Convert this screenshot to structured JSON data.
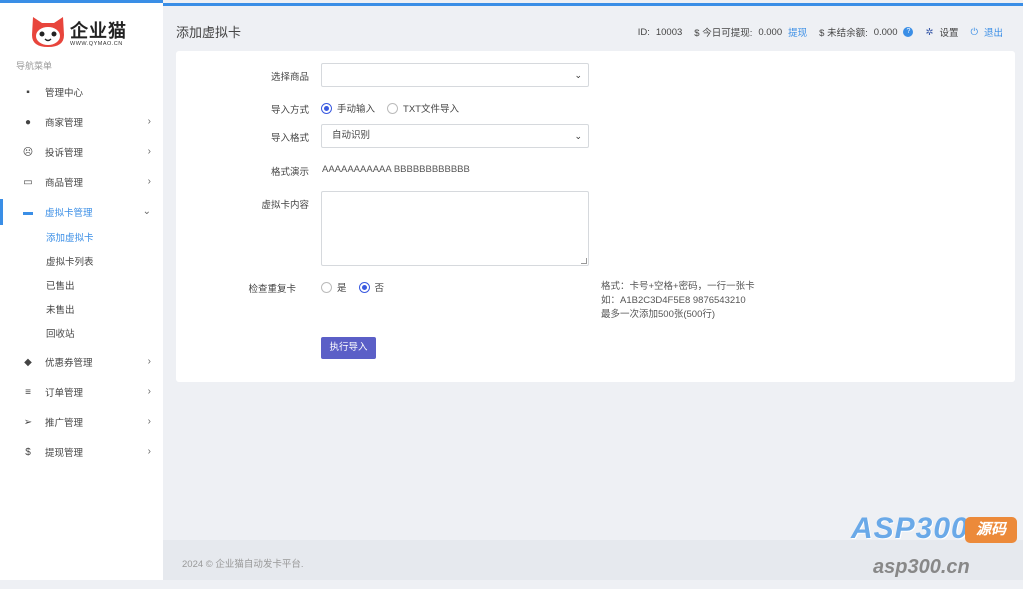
{
  "brand": {
    "name": "企业猫",
    "sub": "WWW.QYMAO.CN"
  },
  "sidebar": {
    "caption": "导航菜单",
    "items": [
      {
        "label": "管理中心",
        "icon": "dashboard-icon",
        "arrow": false
      },
      {
        "label": "商家管理",
        "icon": "user-icon",
        "arrow": true
      },
      {
        "label": "投诉管理",
        "icon": "complaint-icon",
        "arrow": true
      },
      {
        "label": "商品管理",
        "icon": "store-icon",
        "arrow": true
      },
      {
        "label": "虚拟卡管理",
        "icon": "card-icon",
        "arrow": true,
        "active": true
      },
      {
        "label": "优惠券管理",
        "icon": "tag-icon",
        "arrow": true
      },
      {
        "label": "订单管理",
        "icon": "list-icon",
        "arrow": true
      },
      {
        "label": "推广管理",
        "icon": "send-icon",
        "arrow": true
      },
      {
        "label": "提现管理",
        "icon": "dollar-icon",
        "arrow": true
      }
    ],
    "sub_items": [
      "添加虚拟卡",
      "虚拟卡列表",
      "已售出",
      "未售出",
      "回收站"
    ]
  },
  "header": {
    "title": "添加虚拟卡",
    "id_label": "ID:",
    "id_value": "10003",
    "withdraw_label": "$ 今日可提现:",
    "withdraw_value": "0.000",
    "withdraw_link": "提现",
    "unsettled_label": "$ 未结余额:",
    "unsettled_value": "0.000",
    "settings": "设置",
    "logout": "退出"
  },
  "form": {
    "product_label": "选择商品",
    "product_value": "",
    "import_mode_label": "导入方式",
    "import_modes": [
      "手动输入",
      "TXT文件导入"
    ],
    "import_mode_selected": "手动输入",
    "format_label": "导入格式",
    "format_value": "自动识别",
    "demo_label": "格式演示",
    "demo_value": "AAAAAAAAAAA BBBBBBBBBBBB",
    "content_label": "虚拟卡内容",
    "content_value": "",
    "dup_label": "检查重复卡",
    "dup_options": [
      "是",
      "否"
    ],
    "dup_selected": "否",
    "hint_lines": [
      "格式：卡号+空格+密码，一行一张卡",
      "如：A1B2C3D4F5E8 9876543210",
      "最多一次添加500张(500行)"
    ],
    "submit": "执行导入"
  },
  "footer": {
    "text": "2024 © 企业猫自动发卡平台."
  },
  "watermark": {
    "main": "ASP300",
    "badge": "源码",
    "url": "asp300.cn"
  },
  "colors": {
    "accent": "#3a8ee6",
    "button": "#5b5fc7"
  }
}
